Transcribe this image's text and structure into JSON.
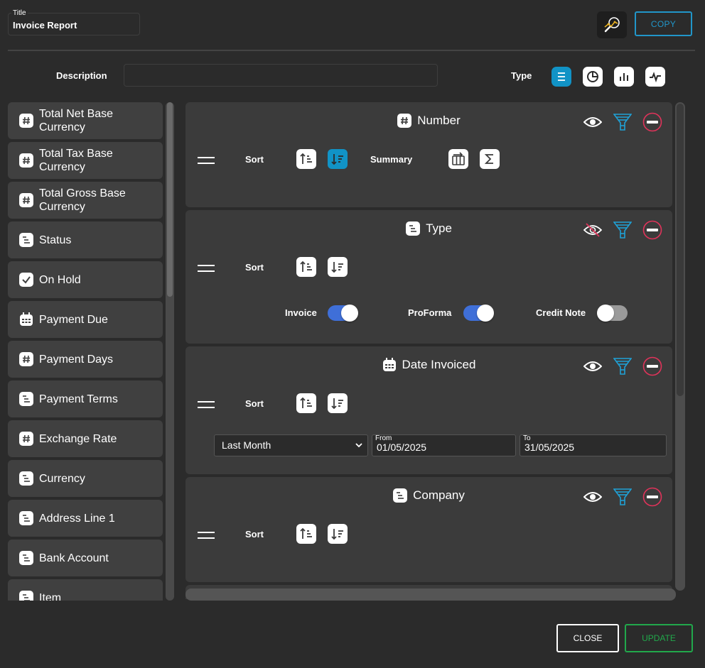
{
  "header": {
    "title_caption": "Title",
    "title_value": "Invoice Report",
    "copy_label": "COPY"
  },
  "description": {
    "label": "Description",
    "value": ""
  },
  "type": {
    "label": "Type",
    "options": [
      {
        "icon": "list-icon",
        "active": true
      },
      {
        "icon": "pie-chart-icon",
        "active": false
      },
      {
        "icon": "bar-chart-icon",
        "active": false
      },
      {
        "icon": "line-chart-icon",
        "active": false
      }
    ]
  },
  "fields": [
    {
      "label": "Total Net Base Currency",
      "icon": "hash-icon"
    },
    {
      "label": "Total Tax Base Currency",
      "icon": "hash-icon"
    },
    {
      "label": "Total Gross Base Currency",
      "icon": "hash-icon"
    },
    {
      "label": "Status",
      "icon": "text-icon"
    },
    {
      "label": "On Hold",
      "icon": "checkbox-icon"
    },
    {
      "label": "Payment Due",
      "icon": "calendar-icon"
    },
    {
      "label": "Payment Days",
      "icon": "hash-icon"
    },
    {
      "label": "Payment Terms",
      "icon": "text-icon"
    },
    {
      "label": "Exchange Rate",
      "icon": "hash-icon"
    },
    {
      "label": "Currency",
      "icon": "text-icon"
    },
    {
      "label": "Address Line 1",
      "icon": "text-icon"
    },
    {
      "label": "Bank Account",
      "icon": "text-icon"
    },
    {
      "label": "Item",
      "icon": "text-icon"
    }
  ],
  "cards": {
    "sort_label": "Sort",
    "number": {
      "title": "Number",
      "summary_label": "Summary"
    },
    "type": {
      "title": "Type",
      "invoice": "Invoice",
      "proforma": "ProForma",
      "credit_note": "Credit Note"
    },
    "date": {
      "title": "Date Invoiced",
      "period": "Last Month",
      "from_caption": "From",
      "from_value": "01/05/2025",
      "to_caption": "To",
      "to_value": "31/05/2025"
    },
    "company": {
      "title": "Company"
    }
  },
  "footer": {
    "close_label": "CLOSE",
    "update_label": "UPDATE"
  },
  "colors": {
    "accent": "#1193c6",
    "update": "#21a84b",
    "remove": "#e0335a"
  }
}
